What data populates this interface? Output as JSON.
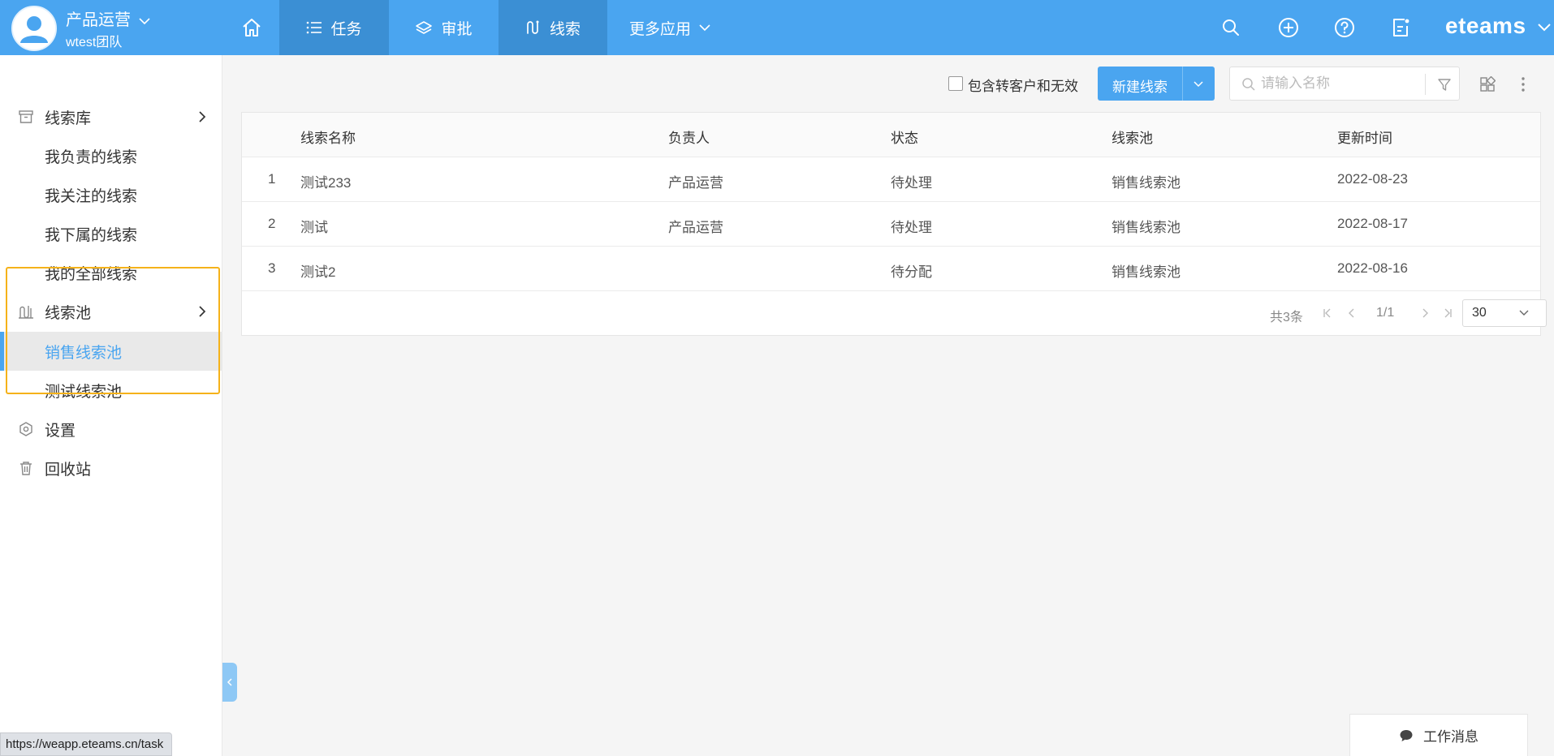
{
  "header": {
    "user_name": "产品运营",
    "team_name": "wtest团队",
    "tabs": [
      {
        "label": "任务",
        "icon": "list-icon"
      },
      {
        "label": "审批",
        "icon": "layers-icon"
      },
      {
        "label": "线索",
        "icon": "lead-icon"
      }
    ],
    "more_apps": "更多应用",
    "brand": "eteams",
    "colors": {
      "bar": "#4aa5f0",
      "tab_active": "#3b8fd4"
    }
  },
  "sidebar": {
    "library": {
      "label": "线索库",
      "icon": "archive-icon"
    },
    "library_items": [
      "我负责的线索",
      "我关注的线索",
      "我下属的线索",
      "我的全部线索"
    ],
    "pool": {
      "label": "线索池",
      "icon": "pool-icon"
    },
    "pool_items": [
      {
        "label": "销售线索池",
        "active": true
      },
      {
        "label": "测试线索池",
        "active": false
      }
    ],
    "settings": {
      "label": "设置",
      "icon": "settings-hex-icon"
    },
    "recycle": {
      "label": "回收站",
      "icon": "trash-icon"
    },
    "highlight_color": "#f5b21a"
  },
  "toolbar": {
    "include_label": "包含转客户和无效",
    "include_checked": false,
    "new_button": "新建线索",
    "search_placeholder": "请输入名称",
    "search_value": ""
  },
  "table": {
    "columns": [
      "线索名称",
      "负责人",
      "状态",
      "线索池",
      "更新时间"
    ],
    "rows": [
      {
        "index": "1",
        "name": "测试233",
        "owner": "产品运营",
        "status": "待处理",
        "pool": "销售线索池",
        "updated": "2022-08-23"
      },
      {
        "index": "2",
        "name": "测试",
        "owner": "产品运营",
        "status": "待处理",
        "pool": "销售线索池",
        "updated": "2022-08-17"
      },
      {
        "index": "3",
        "name": "测试2",
        "owner": "",
        "status": "待分配",
        "pool": "销售线索池",
        "updated": "2022-08-16"
      }
    ]
  },
  "pagination": {
    "total": "共3条",
    "page": "1/1",
    "page_size": "30"
  },
  "statusbar": {
    "url": "https://weapp.eteams.cn/task"
  },
  "work_messages": {
    "label": "工作消息"
  }
}
